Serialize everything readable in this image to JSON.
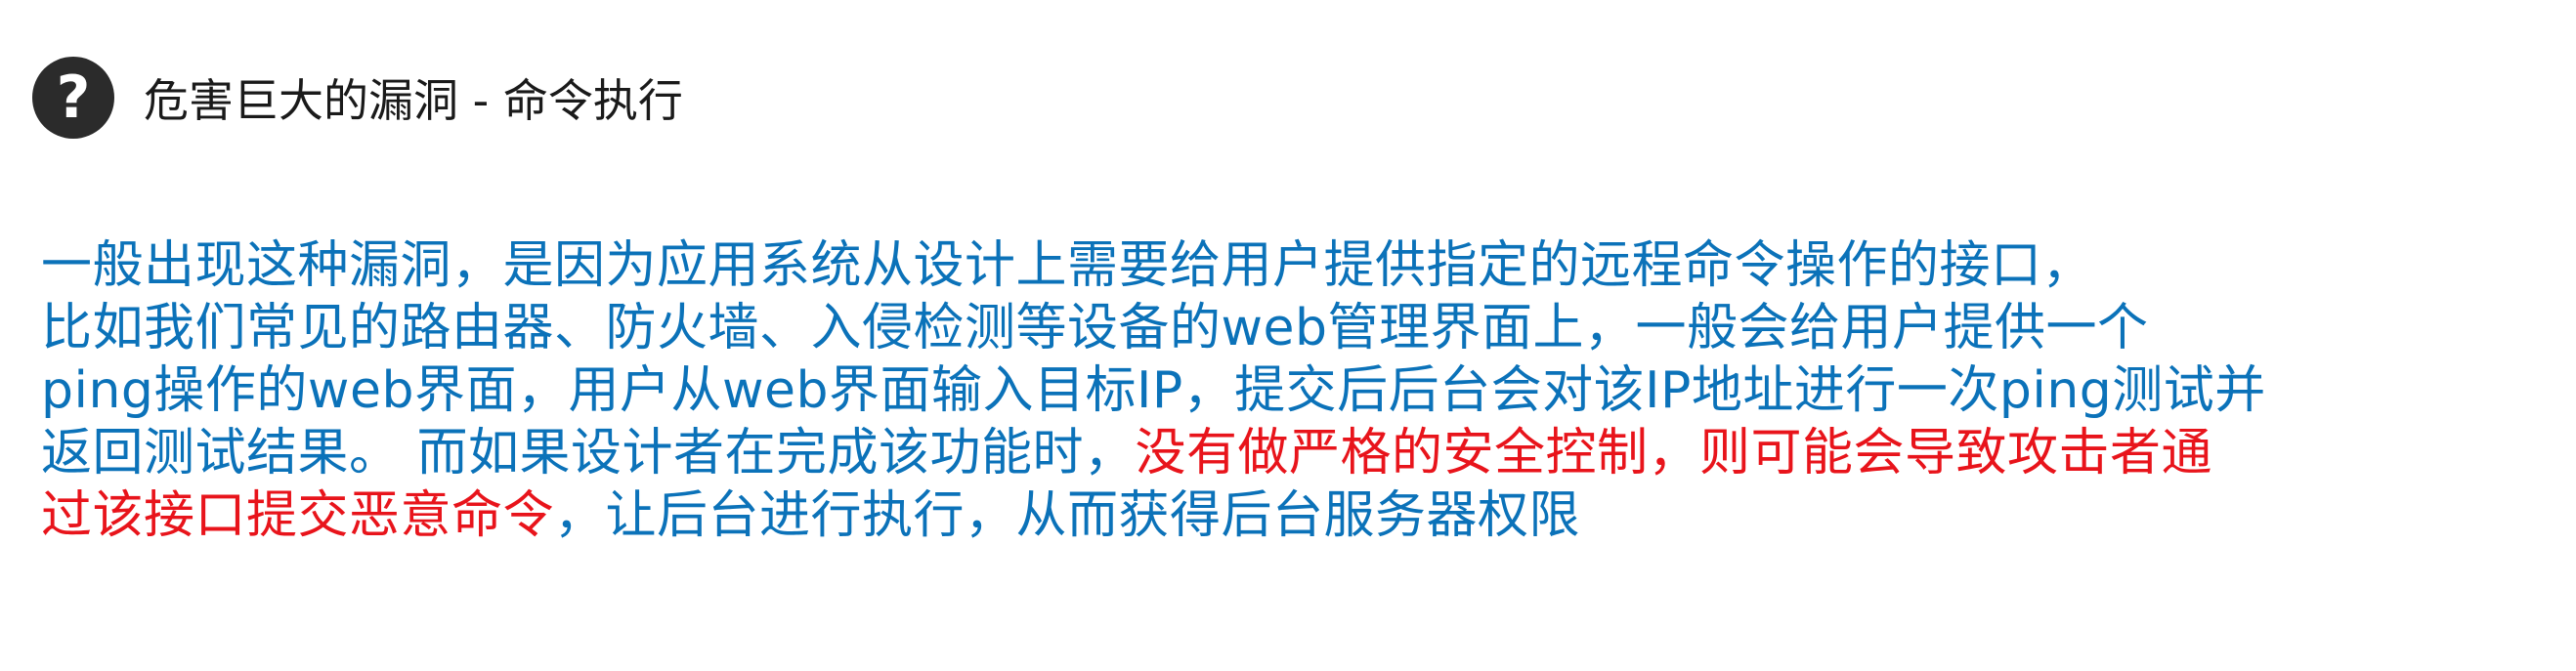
{
  "header": {
    "icon": "question-circle-icon",
    "title": "危害巨大的漏洞 - 命令执行"
  },
  "paragraph": {
    "line1": "一般出现这种漏洞，是因为应用系统从设计上需要给用户提供指定的远程命令操作的接口，",
    "line2": "比如我们常见的路由器、防火墙、入侵检测等设备的web管理界面上，一般会给用户提供一个",
    "line3": "ping操作的web界面，用户从web界面输入目标IP，提交后后台会对该IP地址进行一次ping测试并",
    "line4_normal": "返回测试结果。 而如果设计者在完成该功能时，",
    "line4_red": "没有做严格的安全控制，则可能会导致攻击者通",
    "line5_red": "过该接口提交恶意命令",
    "line5_normal": "，让后台进行执行，从而获得后台服务器权限"
  },
  "colors": {
    "text_blue": "#0b72b9",
    "text_red": "#e8141b",
    "title": "#1a1a1a",
    "icon_bg": "#2b2b2b"
  }
}
